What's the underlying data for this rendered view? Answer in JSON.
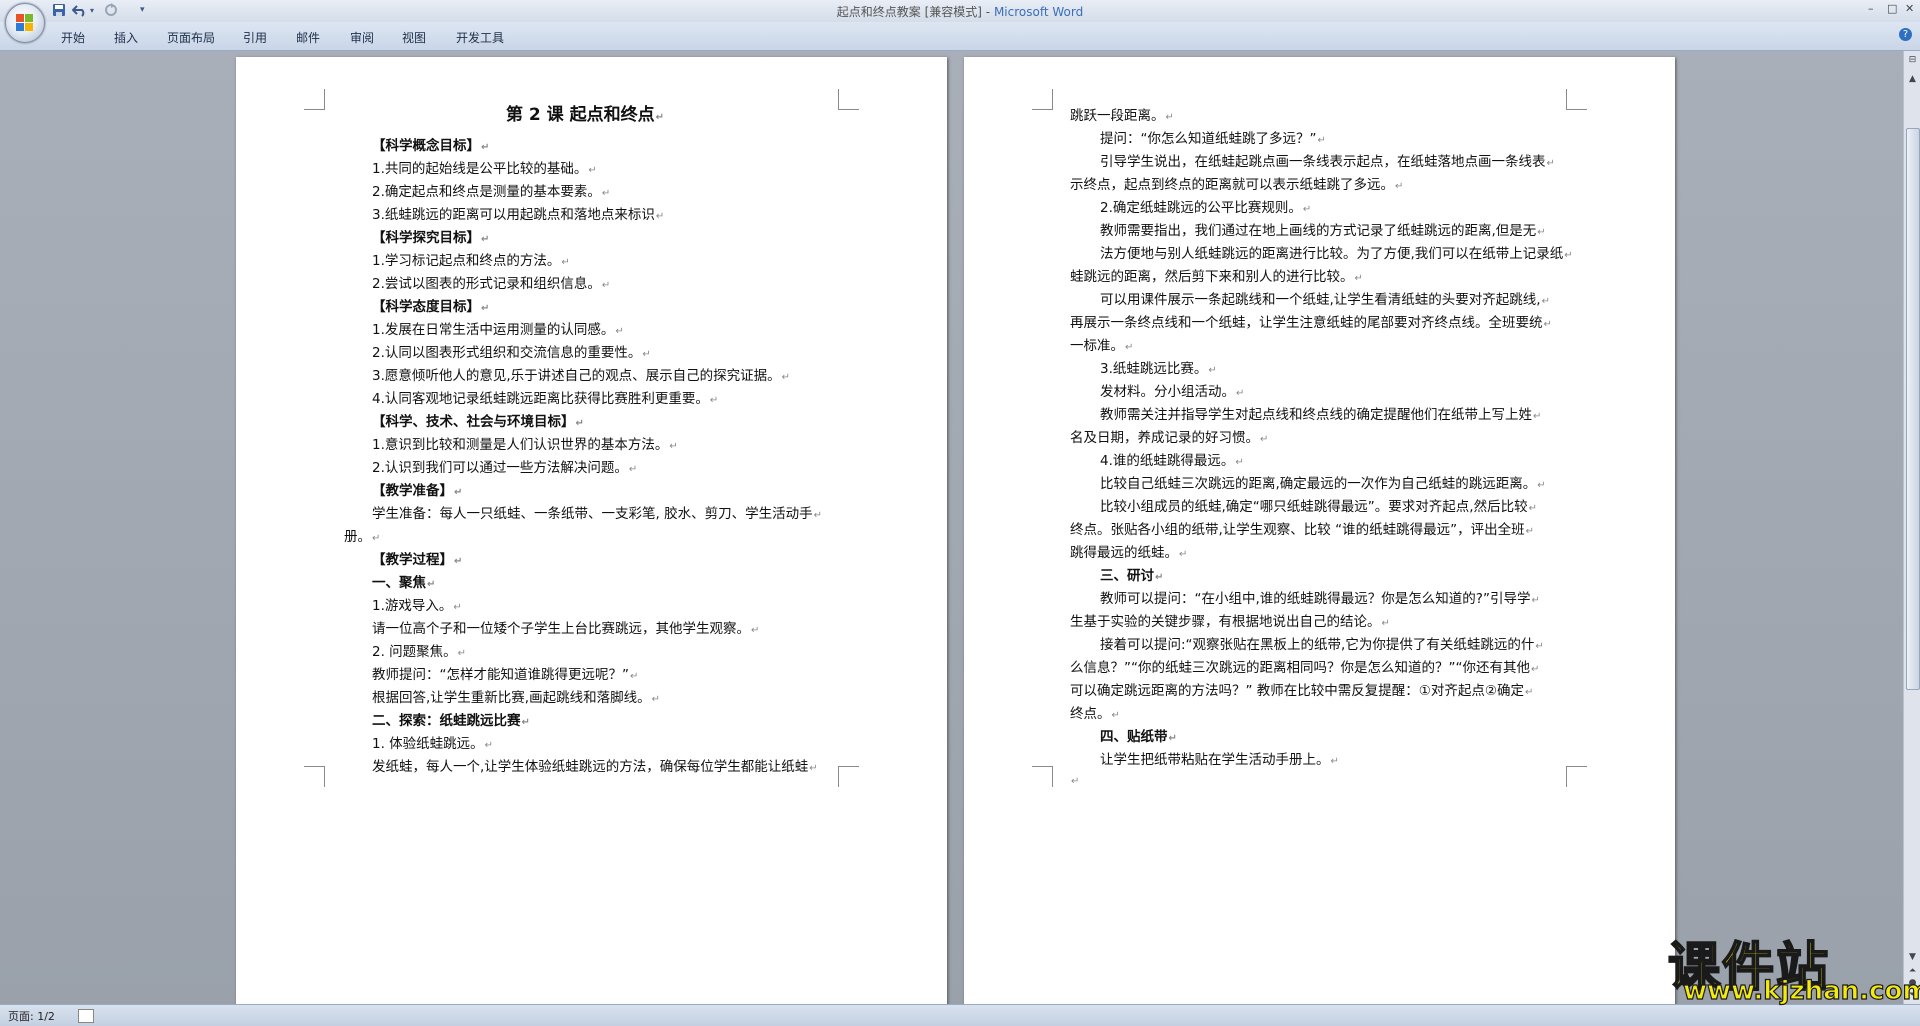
{
  "window": {
    "title": "起点和终点教案 [兼容模式]",
    "separator": " - ",
    "app_name": "Microsoft Word",
    "controls": [
      "–",
      "□",
      "✕"
    ]
  },
  "ribbon": {
    "tabs": [
      "开始",
      "插入",
      "页面布局",
      "引用",
      "邮件",
      "审阅",
      "视图",
      "开发工具"
    ]
  },
  "page1": {
    "lines": [
      "第 2 课 起点和终点",
      "【科学概念目标】",
      "1.共同的起始线是公平比较的基础。",
      "2.确定起点和终点是测量的基本要素。",
      "3.纸蛙跳远的距离可以用起跳点和落地点来标识",
      "【科学探究目标】",
      "1.学习标记起点和终点的方法。",
      "2.尝试以图表的形式记录和组织信息。",
      "【科学态度目标】",
      "1.发展在日常生活中运用测量的认同感。",
      "2.认同以图表形式组织和交流信息的重要性。",
      "3.愿意倾听他人的意见,乐于讲述自己的观点、展示自己的探究证据。",
      "4.认同客观地记录纸蛙跳远距离比获得比赛胜利更重要。",
      "【科学、技术、社会与环境目标】",
      "1.意识到比较和测量是人们认识世界的基本方法。",
      "2.认识到我们可以通过一些方法解决问题。",
      "【教学准备】",
      "学生准备：每人一只纸蛙、一条纸带、一支彩笔, 胶水、剪刀、学生活动手",
      "册。",
      "【教学过程】",
      "一、聚焦",
      "1.游戏导入。",
      "请一位高个子和一位矮个子学生上台比赛跳远，其他学生观察。",
      "2. 问题聚焦。",
      "教师提问：“怎样才能知道谁跳得更远呢？”",
      "根据回答,让学生重新比赛,画起跳线和落脚线。",
      "二、探索：纸蛙跳远比赛",
      "1. 体验纸蛙跳远。",
      "发纸蛙，每人一个,让学生体验纸蛙跳远的方法，确保每位学生都能让纸蛙"
    ]
  },
  "page2": {
    "lines": [
      "跳跃一段距离。",
      "提问：“你怎么知道纸蛙跳了多远？”",
      "引导学生说出，在纸蛙起跳点画一条线表示起点，在纸蛙落地点画一条线表",
      "示终点，起点到终点的距离就可以表示纸蛙跳了多远。",
      "2.确定纸蛙跳远的公平比赛规则。",
      "教师需要指出，我们通过在地上画线的方式记录了纸蛙跳远的距离,但是无",
      "法方便地与别人纸蛙跳远的距离进行比较。为了方便,我们可以在纸带上记录纸",
      "蛙跳远的距离，然后剪下来和别人的进行比较。",
      "可以用课件展示一条起跳线和一个纸蛙,让学生看清纸蛙的头要对齐起跳线,",
      "再展示一条终点线和一个纸蛙，让学生注意纸蛙的尾部要对齐终点线。全班要统",
      "一标准。",
      "3.纸蛙跳远比赛。",
      "发材料。分小组活动。",
      "教师需关注并指导学生对起点线和终点线的确定提醒他们在纸带上写上姓",
      "名及日期，养成记录的好习惯。",
      "4.谁的纸蛙跳得最远。",
      "比较自己纸蛙三次跳远的距离,确定最远的一次作为自己纸蛙的跳远距离。",
      "比较小组成员的纸蛙,确定“哪只纸蛙跳得最远”。要求对齐起点,然后比较",
      "终点。张贴各小组的纸带,让学生观察、比较 “谁的纸蛙跳得最远”，评出全班",
      "跳得最远的纸蛙。",
      "三、研讨",
      "教师可以提问：“在小组中,谁的纸蛙跳得最远？你是怎么知道的?”引导学",
      "生基于实验的关键步骤，有根据地说出自己的结论。",
      "接着可以提问:“观察张贴在黑板上的纸带,它为你提供了有关纸蛙跳远的什",
      "么信息？”“你的纸蛙三次跳远的距离相同吗？你是怎么知道的？”“你还有其他",
      "可以确定跳远距离的方法吗？” 教师在比较中需反复提醒：①对齐起点②确定",
      "终点。",
      "四、贴纸带",
      "让学生把纸带粘贴在学生活动手册上。",
      ""
    ]
  },
  "status": {
    "page_indicator": "页面: 1/2"
  },
  "watermark": {
    "text": "课件站",
    "url": "www.kjzhan.com"
  },
  "pilcrow": "↵"
}
